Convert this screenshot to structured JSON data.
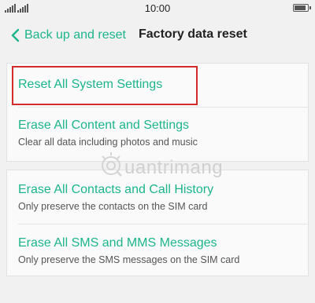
{
  "status_bar": {
    "time": "10:00",
    "battery_level": 0.85,
    "icons": [
      "signal-icon",
      "signal-icon",
      "battery-icon"
    ]
  },
  "header": {
    "back_label": "Back up and reset",
    "title": "Factory data reset",
    "back_icon": "chevron-left-icon"
  },
  "groups": [
    {
      "items": [
        {
          "title": "Reset All System Settings",
          "subtitle": ""
        },
        {
          "title": "Erase All Content and Settings",
          "subtitle": "Clear all data including photos and music"
        }
      ]
    },
    {
      "items": [
        {
          "title": "Erase All Contacts and Call History",
          "subtitle": "Only preserve the contacts on the SIM card"
        },
        {
          "title": "Erase All SMS and MMS Messages",
          "subtitle": "Only preserve the SMS messages on the SIM card"
        }
      ]
    }
  ],
  "highlighted_item": "Reset All System Settings",
  "colors": {
    "accent": "#1cb58b",
    "highlight_border": "#d42a2a",
    "background": "#f1f1f1",
    "card": "#fafafa"
  },
  "watermark": {
    "text": "uantrimang",
    "logo_icon": "quantrimang-logo-icon"
  }
}
